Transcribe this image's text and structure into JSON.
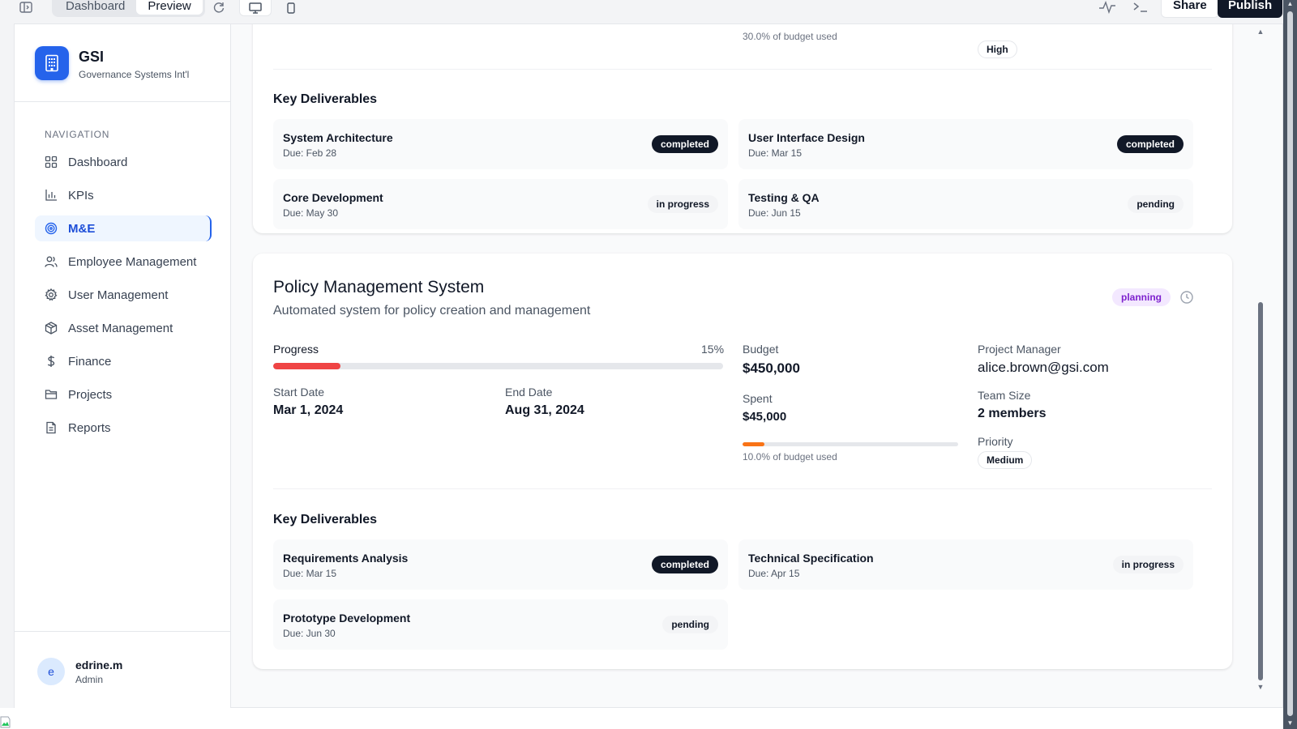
{
  "topbar": {
    "tabs": [
      "Dashboard",
      "Preview"
    ],
    "share_label": "Share",
    "publish_label": "Publish"
  },
  "sidebar": {
    "brand": {
      "name": "GSI",
      "subtitle": "Governance Systems Int'l"
    },
    "nav_heading": "NAVIGATION",
    "items": [
      {
        "label": "Dashboard",
        "icon": "grid-icon"
      },
      {
        "label": "KPIs",
        "icon": "bar-chart-icon"
      },
      {
        "label": "M&E",
        "icon": "target-icon",
        "active": true
      },
      {
        "label": "Employee Management",
        "icon": "users-icon"
      },
      {
        "label": "User Management",
        "icon": "gear-icon"
      },
      {
        "label": "Asset Management",
        "icon": "package-icon"
      },
      {
        "label": "Finance",
        "icon": "dollar-icon"
      },
      {
        "label": "Projects",
        "icon": "folder-icon"
      },
      {
        "label": "Reports",
        "icon": "file-icon"
      }
    ],
    "user": {
      "initial": "e",
      "name": "edrine.m",
      "role": "Admin"
    }
  },
  "previous_project": {
    "budget_used_text": "30.0% of budget used",
    "priority": "High",
    "deliverables_title": "Key Deliverables",
    "deliverables": [
      {
        "name": "System Architecture",
        "due": "Due: Feb 28",
        "status": "completed"
      },
      {
        "name": "User Interface Design",
        "due": "Due: Mar 15",
        "status": "completed"
      },
      {
        "name": "Core Development",
        "due": "Due: May 30",
        "status": "in progress"
      },
      {
        "name": "Testing & QA",
        "due": "Due: Jun 15",
        "status": "pending"
      }
    ]
  },
  "project": {
    "title": "Policy Management System",
    "description": "Automated system for policy creation and management",
    "status": "planning",
    "progress_label": "Progress",
    "progress_text": "15%",
    "progress_value": 0.15,
    "start_label": "Start Date",
    "start_date": "Mar 1, 2024",
    "end_label": "End Date",
    "end_date": "Aug 31, 2024",
    "budget_label": "Budget",
    "budget": "$450,000",
    "spent_label": "Spent",
    "spent": "$45,000",
    "budget_used_value": 0.1,
    "budget_used_text": "10.0% of budget used",
    "manager_label": "Project Manager",
    "manager": "alice.brown@gsi.com",
    "team_label": "Team Size",
    "team_size": "2 members",
    "priority_label": "Priority",
    "priority": "Medium",
    "deliverables_title": "Key Deliverables",
    "deliverables": [
      {
        "name": "Requirements Analysis",
        "due": "Due: Mar 15",
        "status": "completed"
      },
      {
        "name": "Technical Specification",
        "due": "Due: Apr 15",
        "status": "in progress"
      },
      {
        "name": "Prototype Development",
        "due": "Due: Jun 30",
        "status": "pending"
      }
    ]
  },
  "colors": {
    "accent": "#2563eb",
    "progress": "#ef4444",
    "budget": "#f97316",
    "planning_bg": "#f3e8ff",
    "planning_text": "#7e22ce"
  }
}
